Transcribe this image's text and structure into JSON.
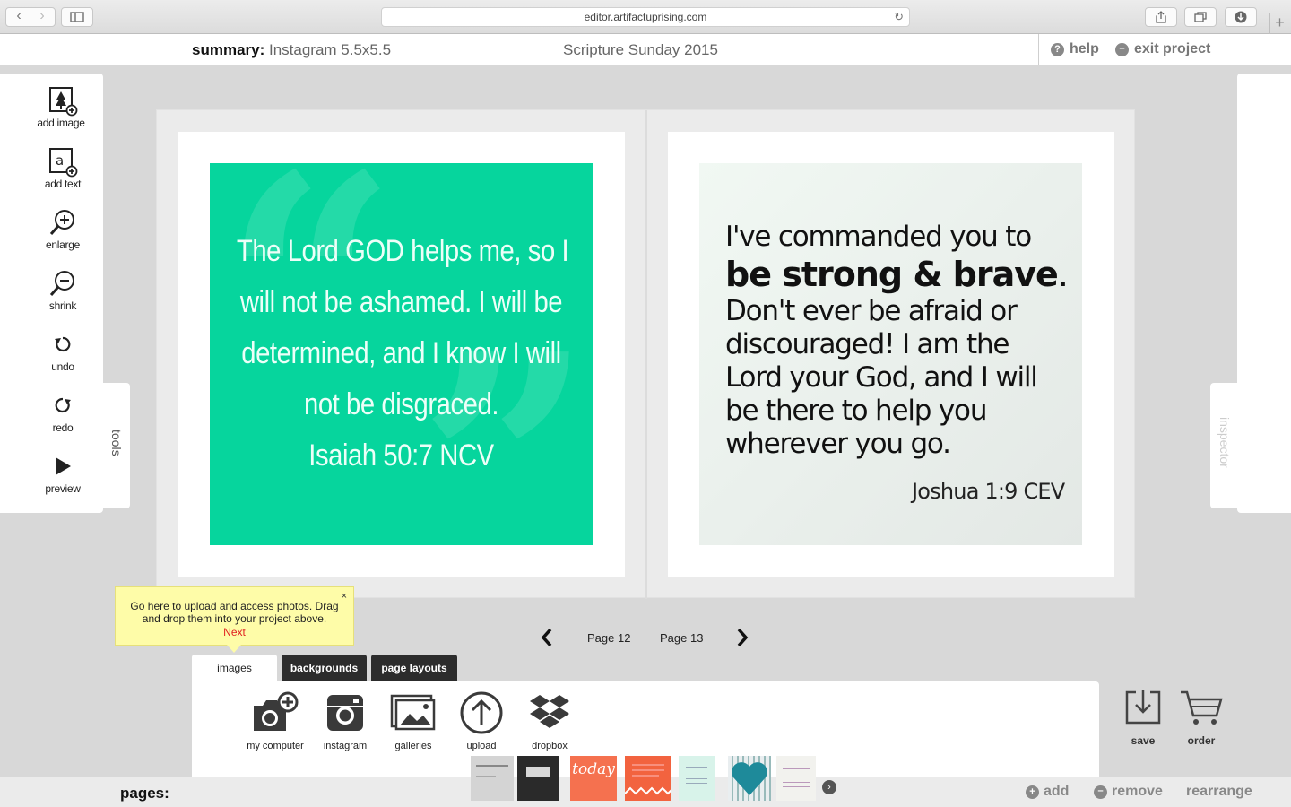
{
  "browser": {
    "url": "editor.artifactuprising.com",
    "back_icon": "‹",
    "forward_icon": "›",
    "new_tab": "+"
  },
  "header": {
    "summary_label": "summary:",
    "summary_value": " Instagram 5.5x5.5",
    "project_title": "Scripture Sunday 2015",
    "help": "help",
    "exit": "exit project"
  },
  "tools": {
    "items": [
      {
        "label": "add image",
        "icon": "add-image-icon"
      },
      {
        "label": "add text",
        "icon": "add-text-icon"
      },
      {
        "label": "enlarge",
        "icon": "zoom-in-icon"
      },
      {
        "label": "shrink",
        "icon": "zoom-out-icon"
      },
      {
        "label": "undo",
        "icon": "undo-icon"
      },
      {
        "label": "redo",
        "icon": "redo-icon"
      },
      {
        "label": "preview",
        "icon": "play-icon"
      }
    ],
    "tab_label": "tools"
  },
  "inspector": {
    "tab_label": "inspector"
  },
  "spread": {
    "left_quote": {
      "lines": [
        "The Lord GOD helps me, so I",
        "will not be ashamed. I will be",
        "determined, and I know I will",
        "not be disgraced.",
        "Isaiah 50:7 NCV"
      ],
      "background": "#06d59d"
    },
    "right_quote": {
      "line1": "I've commanded you to",
      "strong": "be strong & brave",
      "strong_suffix": ".",
      "lines": [
        "Don't ever be afraid or",
        "discouraged! I am the",
        "Lord your God, and I will",
        "be there to help you",
        "wherever you go."
      ],
      "reference": "Joshua 1:9 CEV"
    }
  },
  "tooltip": {
    "text": "Go here to upload and access photos. Drag and drop them into your project above.",
    "next": "Next",
    "close": "×"
  },
  "page_nav": {
    "prev_icon": "‹",
    "next_icon": "›",
    "left_page": "Page 12",
    "right_page": "Page 13"
  },
  "tabs": [
    {
      "label": "images",
      "active": true
    },
    {
      "label": "backgrounds",
      "active": false
    },
    {
      "label": "page layouts",
      "active": false
    }
  ],
  "sources": [
    {
      "label": "my computer",
      "icon": "camera-add-icon"
    },
    {
      "label": "instagram",
      "icon": "instagram-icon"
    },
    {
      "label": "galleries",
      "icon": "gallery-icon"
    },
    {
      "label": "upload",
      "icon": "upload-icon"
    },
    {
      "label": "dropbox",
      "icon": "dropbox-icon"
    }
  ],
  "actions": {
    "save": "save",
    "order": "order"
  },
  "pages_bar": {
    "label": "pages:",
    "add": "add",
    "remove": "remove",
    "rearrange": "rearrange",
    "thumbnails": [
      {
        "color": "#d4d4d4",
        "text": ""
      },
      {
        "color": "#2a2a2a",
        "text": ""
      },
      {
        "color": "#f5714f",
        "text": "today"
      },
      {
        "color": "#f2633f",
        "text": ""
      },
      {
        "color": "#d8f3ea",
        "text": ""
      },
      {
        "color": "#1e9aa8",
        "text": ""
      },
      {
        "color": "#f2f2ee",
        "text": ""
      }
    ]
  }
}
